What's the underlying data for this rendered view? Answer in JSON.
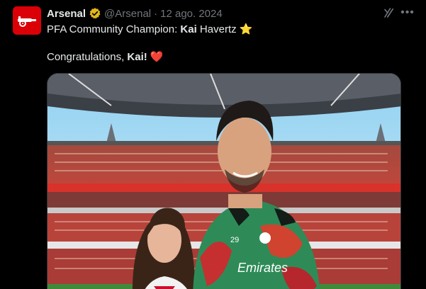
{
  "post": {
    "author_name": "Arsenal",
    "handle": "@Arsenal",
    "separator": "·",
    "date": "12 ago. 2024",
    "text_line1_prefix": "PFA Community Champion: ",
    "text_line1_bold": "Kai",
    "text_line1_suffix": " Havertz ",
    "text_line2_prefix": "Congratulations, ",
    "text_line2_bold": "Kai!",
    "emoji_star": "⭐",
    "emoji_heart": "❤️"
  },
  "actions": {
    "more_label": "•••"
  },
  "media": {
    "shirt_sponsor": "Emirates",
    "shirt_number": "29"
  },
  "colors": {
    "brand_red": "#db0007",
    "verified_gold": "#e2b719",
    "text_primary": "#e7e9ea",
    "text_secondary": "#71767b",
    "background": "#000000"
  },
  "icons": {
    "avatar": "arsenal-cannon-logo",
    "verified": "verified-badge-icon",
    "grok": "grok-icon",
    "more": "more-options-icon"
  }
}
